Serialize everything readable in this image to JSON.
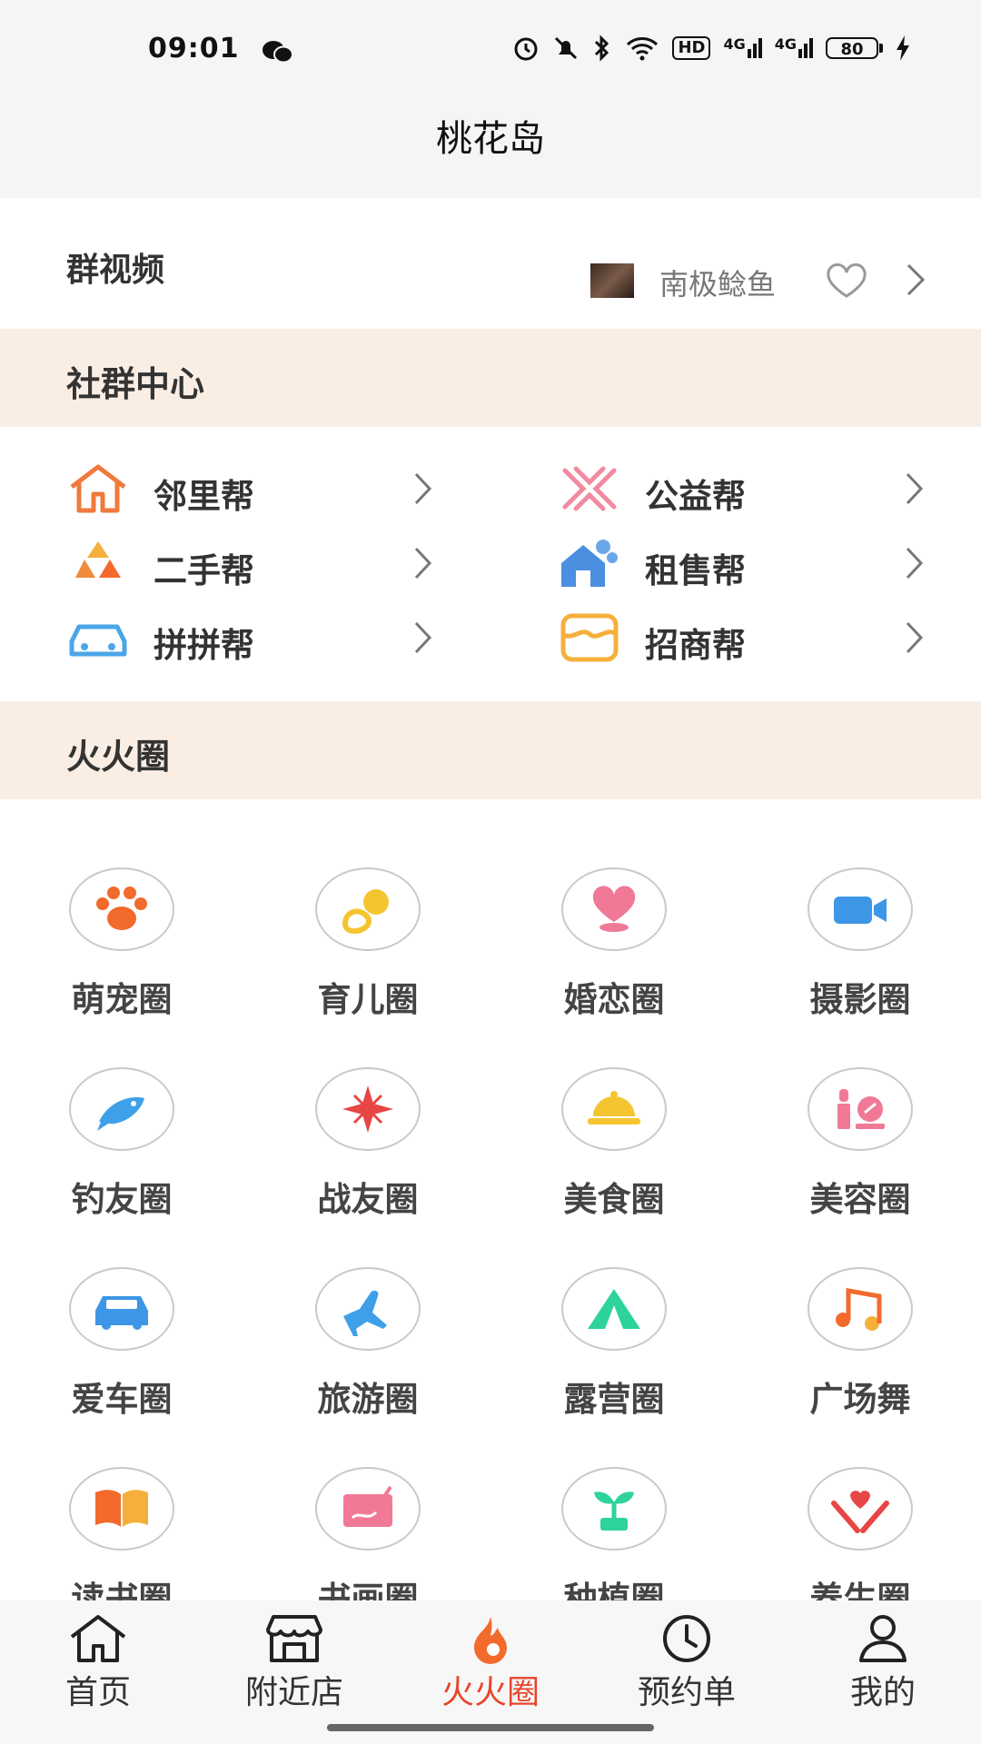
{
  "status_bar": {
    "time": "09:01",
    "hd_badge": "HD",
    "signal1": "4G",
    "signal2": "4G",
    "battery": "80"
  },
  "header": {
    "title": "桃花岛"
  },
  "group_video": {
    "label": "群视频",
    "user_name": "南极鲶鱼"
  },
  "community_center": {
    "title": "社群中心",
    "items": [
      {
        "label": "邻里帮",
        "icon": "house-icon",
        "color": "#f07a3c"
      },
      {
        "label": "公益帮",
        "icon": "handshake-icon",
        "color": "#f28aa0"
      },
      {
        "label": "二手帮",
        "icon": "recycle-icon",
        "color": "#f08a3c"
      },
      {
        "label": "租售帮",
        "icon": "rental-house-icon",
        "color": "#4a8fe0"
      },
      {
        "label": "拼拼帮",
        "icon": "car-icon",
        "color": "#4aa6e8"
      },
      {
        "label": "招商帮",
        "icon": "business-icon",
        "color": "#f5b03c"
      }
    ]
  },
  "hot_circles": {
    "title": "火火圈",
    "items": [
      {
        "label": "萌宠圈",
        "icon": "paw-icon",
        "color": "#f26a2c"
      },
      {
        "label": "育儿圈",
        "icon": "pacifier-icon",
        "color": "#f5c531"
      },
      {
        "label": "婚恋圈",
        "icon": "heart-icon",
        "color": "#f07a96"
      },
      {
        "label": "摄影圈",
        "icon": "video-camera-icon",
        "color": "#3e96e6"
      },
      {
        "label": "钓友圈",
        "icon": "fish-icon",
        "color": "#3ea0e8"
      },
      {
        "label": "战友圈",
        "icon": "compass-star-icon",
        "color": "#e84545"
      },
      {
        "label": "美食圈",
        "icon": "food-cloche-icon",
        "color": "#f5c531"
      },
      {
        "label": "美容圈",
        "icon": "lipstick-icon",
        "color": "#f07a96"
      },
      {
        "label": "爱车圈",
        "icon": "car-icon",
        "color": "#3e96e6"
      },
      {
        "label": "旅游圈",
        "icon": "airplane-icon",
        "color": "#3ea0e8"
      },
      {
        "label": "露营圈",
        "icon": "tent-icon",
        "color": "#2ed39a"
      },
      {
        "label": "广场舞",
        "icon": "music-notes-icon",
        "color": "#f26a2c"
      },
      {
        "label": "读书圈",
        "icon": "book-icon",
        "color": "#f26a2c"
      },
      {
        "label": "书画圈",
        "icon": "painting-icon",
        "color": "#f07a96"
      },
      {
        "label": "种植圈",
        "icon": "sprout-icon",
        "color": "#2ed39a"
      },
      {
        "label": "养生圈",
        "icon": "heart-hands-icon",
        "color": "#e84545"
      }
    ]
  },
  "bottom_nav": {
    "items": [
      {
        "label": "首页",
        "icon": "home-icon"
      },
      {
        "label": "附近店",
        "icon": "store-icon"
      },
      {
        "label": "火火圈",
        "icon": "flame-icon",
        "active": true
      },
      {
        "label": "预约单",
        "icon": "clock-icon"
      },
      {
        "label": "我的",
        "icon": "user-icon"
      }
    ],
    "active_color": "#e8452c"
  }
}
